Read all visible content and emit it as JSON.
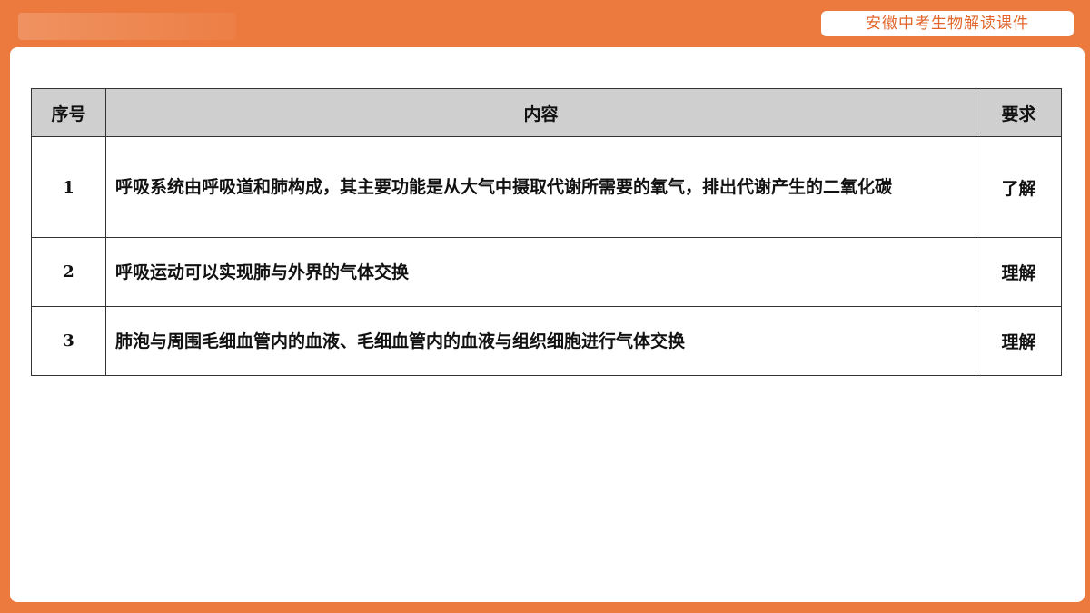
{
  "header": {
    "badge_text": "安徽中考生物解读课件"
  },
  "table": {
    "columns": [
      "序号",
      "内容",
      "要求"
    ],
    "rows": [
      {
        "num": "1",
        "content": "呼吸系统由呼吸道和肺构成，其主要功能是从大气中摄取代谢所需要的氧气，排出代谢产生的二氧化碳",
        "requirement": "了解"
      },
      {
        "num": "2",
        "content": "呼吸运动可以实现肺与外界的气体交换",
        "requirement": "理解"
      },
      {
        "num": "3",
        "content": "肺泡与周围毛细血管内的血液、毛细血管内的血液与组织细胞进行气体交换",
        "requirement": "理解"
      }
    ]
  },
  "colors": {
    "frame": "#EC7A3E",
    "badge_text": "#E2662A",
    "header_bg": "#CFCFCF"
  }
}
